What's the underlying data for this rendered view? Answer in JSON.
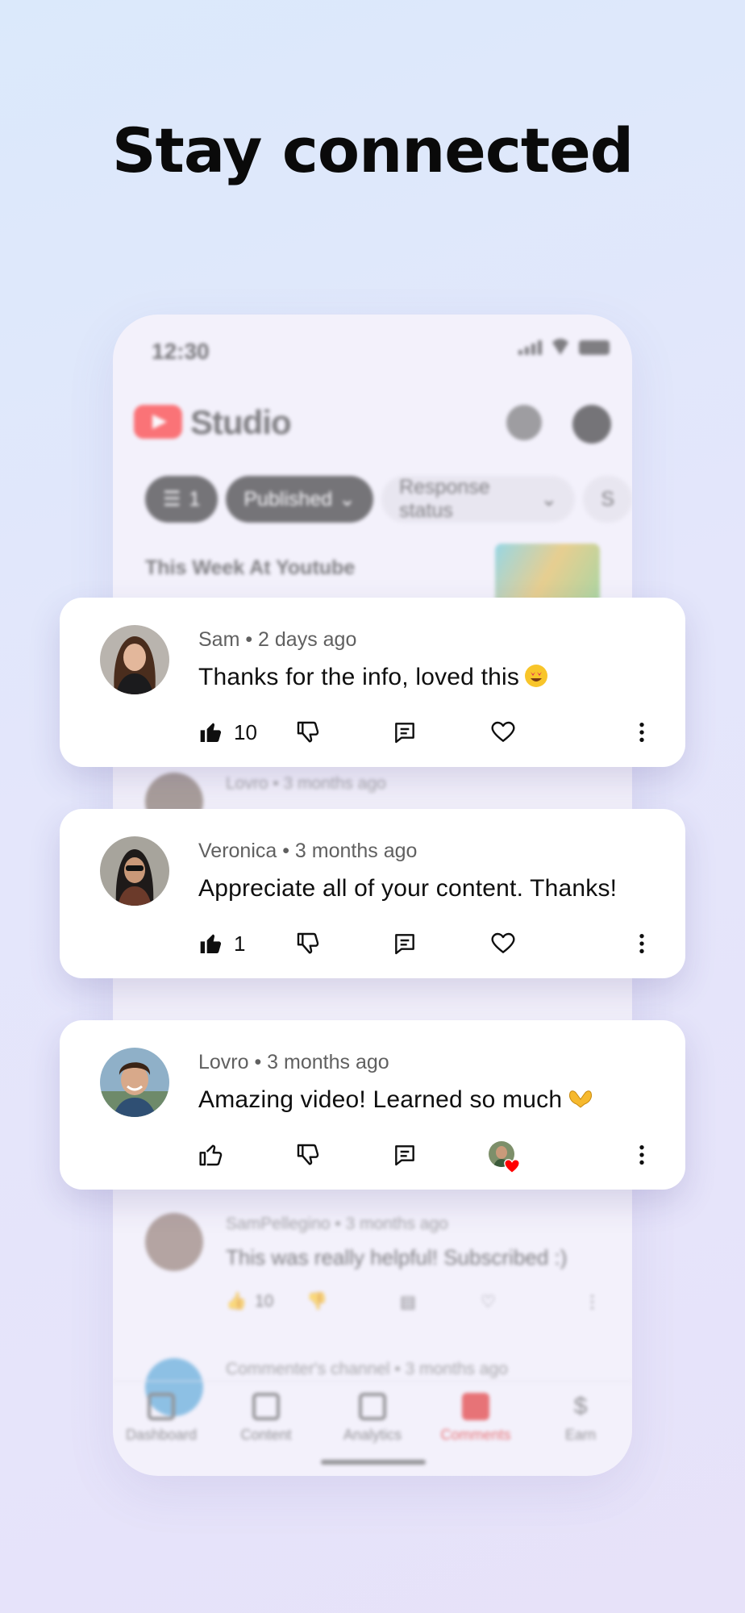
{
  "headline": "Stay connected",
  "phone": {
    "status_time": "12:30",
    "app_name": "Studio",
    "help_badge": "0",
    "filter_chips": [
      {
        "label": "1"
      },
      {
        "label": "Published"
      },
      {
        "label": "Response status"
      },
      {
        "label": "S"
      }
    ],
    "video_title": "This Week At Youtube",
    "background_comments": [
      {
        "meta": "Lovro • 3 months ago",
        "text": "",
        "likes": ""
      },
      {
        "meta": "",
        "text": "",
        "likes": "1"
      },
      {
        "meta": "SamPellegino • 3 months ago",
        "text": "This was really helpful! Subscribed :)",
        "likes": "10"
      },
      {
        "meta": "Commenter's channel • 3 months ago",
        "text": "",
        "likes": ""
      }
    ],
    "bottom_nav": [
      {
        "label": "Dashboard"
      },
      {
        "label": "Content"
      },
      {
        "label": "Analytics"
      },
      {
        "label": "Comments"
      },
      {
        "label": "Earn"
      }
    ]
  },
  "comments": [
    {
      "meta": "Sam • 2 days ago",
      "text": "Thanks for the info, loved this",
      "emoji": "heart-eyes-emoji",
      "likes": "10",
      "liked": true,
      "creator_hearted": false
    },
    {
      "meta": "Veronica • 3 months ago",
      "text": "Appreciate all of your content. Thanks!",
      "emoji": "",
      "likes": "1",
      "liked": true,
      "creator_hearted": false
    },
    {
      "meta": "Lovro • 3 months ago",
      "text": "Amazing video! Learned so much",
      "emoji": "heart-hands-emoji",
      "likes": "",
      "liked": false,
      "creator_hearted": true
    }
  ],
  "colors": {
    "accent": "#e02020",
    "heart": "#ff0000"
  }
}
